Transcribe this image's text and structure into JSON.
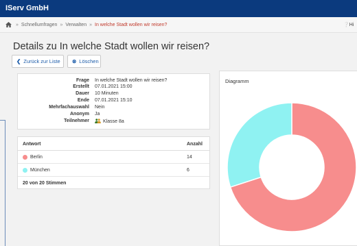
{
  "header": {
    "brand": "IServ GmbH"
  },
  "breadcrumb": {
    "items": [
      "Schnellumfragen",
      "Verwalten"
    ],
    "sep": "»",
    "active": "In welche Stadt wollen wir reisen?"
  },
  "help_label": "Hi",
  "page": {
    "title": "Details zu In welche Stadt wollen wir reisen?"
  },
  "buttons": {
    "back": "Zurück zur Liste",
    "delete": "Löschen"
  },
  "details": [
    {
      "label": "Frage",
      "value": "In welche Stadt wollen wir reisen?"
    },
    {
      "label": "Erstellt",
      "value": "07.01.2021 15:00"
    },
    {
      "label": "Dauer",
      "value": "10 Minuten"
    },
    {
      "label": "Ende",
      "value": "07.01.2021 15:10"
    },
    {
      "label": "Mehrfachauswahl",
      "value": "Nein"
    },
    {
      "label": "Anonym",
      "value": "Ja"
    },
    {
      "label": "Teilnehmer",
      "value": "Klasse 8a"
    }
  ],
  "answers": {
    "col_answer": "Antwort",
    "col_count": "Anzahl",
    "rows": [
      {
        "label": "Berlin",
        "count": "14",
        "color": "#f78d8d"
      },
      {
        "label": "München",
        "count": "6",
        "color": "#8ff2f2"
      }
    ],
    "footer": "20 von 20 Stimmen"
  },
  "chart": {
    "title": "Diagramm"
  },
  "chart_data": {
    "type": "pie",
    "categories": [
      "Berlin",
      "München"
    ],
    "values": [
      14,
      6
    ],
    "colors": [
      "#f78d8d",
      "#8ff2f2"
    ]
  }
}
